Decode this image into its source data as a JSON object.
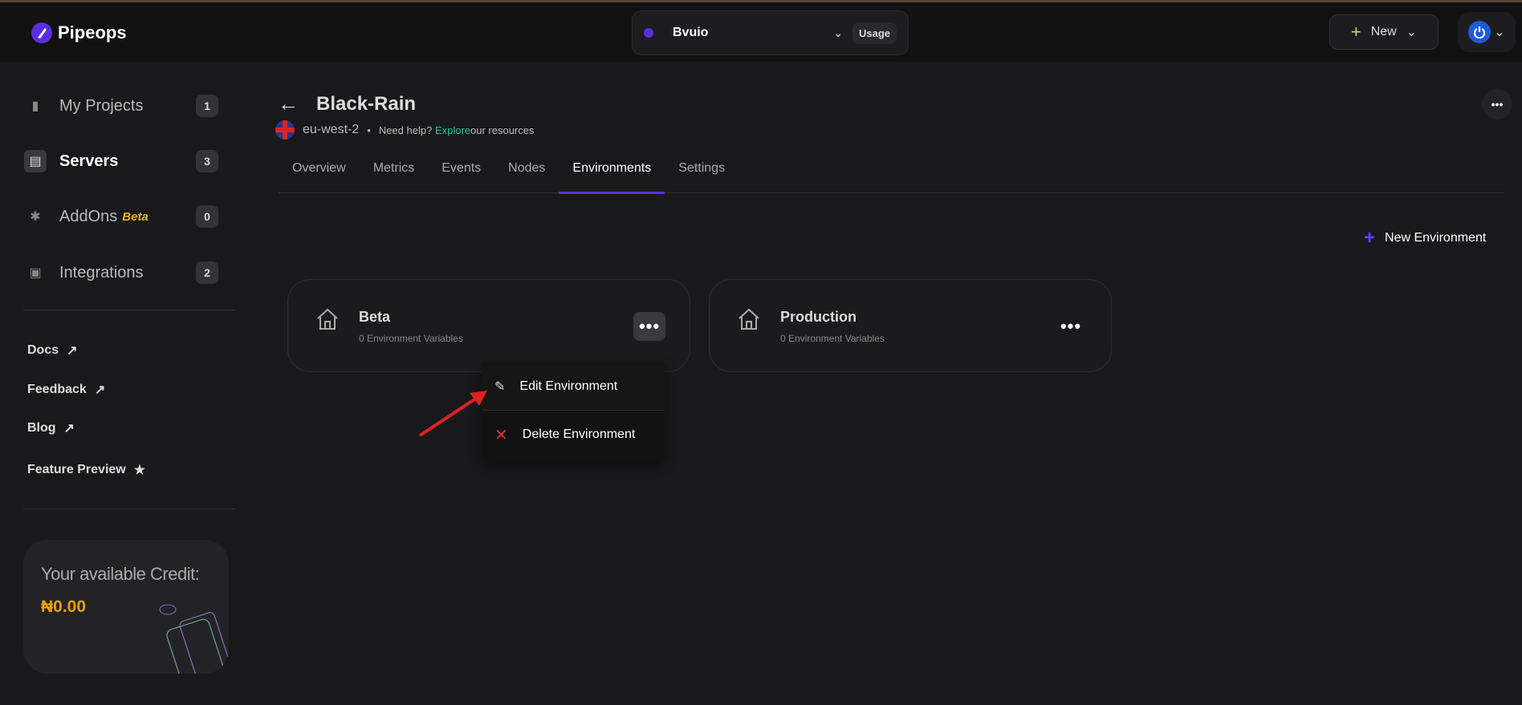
{
  "header": {
    "brand": "Pipeops",
    "workspace": "Bvuio",
    "usage_label": "Usage",
    "new_label": "New"
  },
  "sidebar": {
    "items": [
      {
        "label": "My Projects",
        "count": "1"
      },
      {
        "label": "Servers",
        "count": "3"
      },
      {
        "label": "AddOns",
        "tag": "Beta",
        "count": "0"
      },
      {
        "label": "Integrations",
        "count": "2"
      }
    ],
    "links": [
      "Docs",
      "Feedback",
      "Blog",
      "Feature Preview"
    ],
    "credit": {
      "title": "Your available Credit:",
      "value": "₦0.00"
    }
  },
  "page": {
    "title": "Black-Rain",
    "region": "eu-west-2",
    "help": "Need help?",
    "explore": "Explore",
    "resources": "our resources",
    "tabs": [
      "Overview",
      "Metrics",
      "Events",
      "Nodes",
      "Environments",
      "Settings"
    ],
    "active_tab": "Environments",
    "new_env": "New Environment",
    "environments": [
      {
        "name": "Beta",
        "vars": "0 Environment Variables"
      },
      {
        "name": "Production",
        "vars": "0 Environment Variables"
      }
    ],
    "menu": {
      "edit": "Edit Environment",
      "delete": "Delete Environment"
    }
  },
  "colors": {
    "accent": "#5b2de0",
    "credit": "#e6a000",
    "explore": "#2ac1a5",
    "annotation": "#e02020"
  }
}
